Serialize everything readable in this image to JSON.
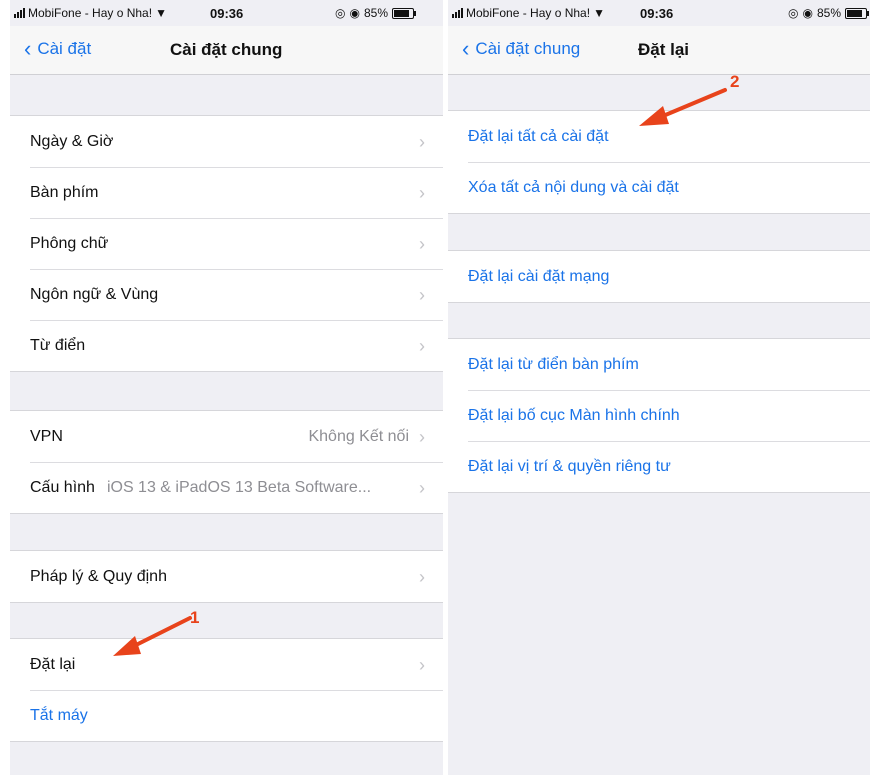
{
  "left": {
    "status": {
      "carrier": "MobiFone - Hay o Nha!",
      "time": "09:36",
      "battery": "85%",
      "battery_level": 0.85
    },
    "back_label": "Cài đặt",
    "title": "Cài đặt chung",
    "groups": [
      {
        "rows": [
          {
            "label": "Ngày & Giờ"
          },
          {
            "label": "Bàn phím"
          },
          {
            "label": "Phông chữ"
          },
          {
            "label": "Ngôn ngữ & Vùng"
          },
          {
            "label": "Từ điển"
          }
        ]
      },
      {
        "rows": [
          {
            "label": "VPN",
            "detail": "Không Kết nối"
          },
          {
            "label": "Cấu hình",
            "detail": "iOS 13 & iPadOS 13 Beta Software..."
          }
        ]
      },
      {
        "rows": [
          {
            "label": "Pháp lý & Quy định"
          }
        ]
      },
      {
        "rows": [
          {
            "label": "Đặt lại"
          },
          {
            "label": "Tắt máy"
          }
        ]
      }
    ],
    "annotation_number": "1"
  },
  "right": {
    "status": {
      "carrier": "MobiFone - Hay o Nha!",
      "time": "09:36",
      "battery": "85%",
      "battery_level": 0.85
    },
    "back_label": "Cài đặt chung",
    "title": "Đặt lại",
    "groups": [
      {
        "rows": [
          {
            "label": "Đặt lại tất cả cài đặt"
          },
          {
            "label": "Xóa tất cả nội dung và cài đặt"
          }
        ]
      },
      {
        "rows": [
          {
            "label": "Đặt lại cài đặt mạng"
          }
        ]
      },
      {
        "rows": [
          {
            "label": "Đặt lại từ điển bàn phím"
          },
          {
            "label": "Đặt lại bố cục Màn hình chính"
          },
          {
            "label": "Đặt lại vị trí & quyền riêng tư"
          }
        ]
      }
    ],
    "annotation_number": "2"
  },
  "colors": {
    "accent": "#1a73e8",
    "annotation": "#e8431b",
    "background": "#efeff4"
  },
  "icons": {
    "back": "chevron-left-icon",
    "row": "chevron-right-icon",
    "wifi": "wifi-icon",
    "signal": "signal-icon",
    "battery": "battery-icon",
    "alarm": "alarm-icon",
    "lock": "orientation-lock-icon"
  }
}
